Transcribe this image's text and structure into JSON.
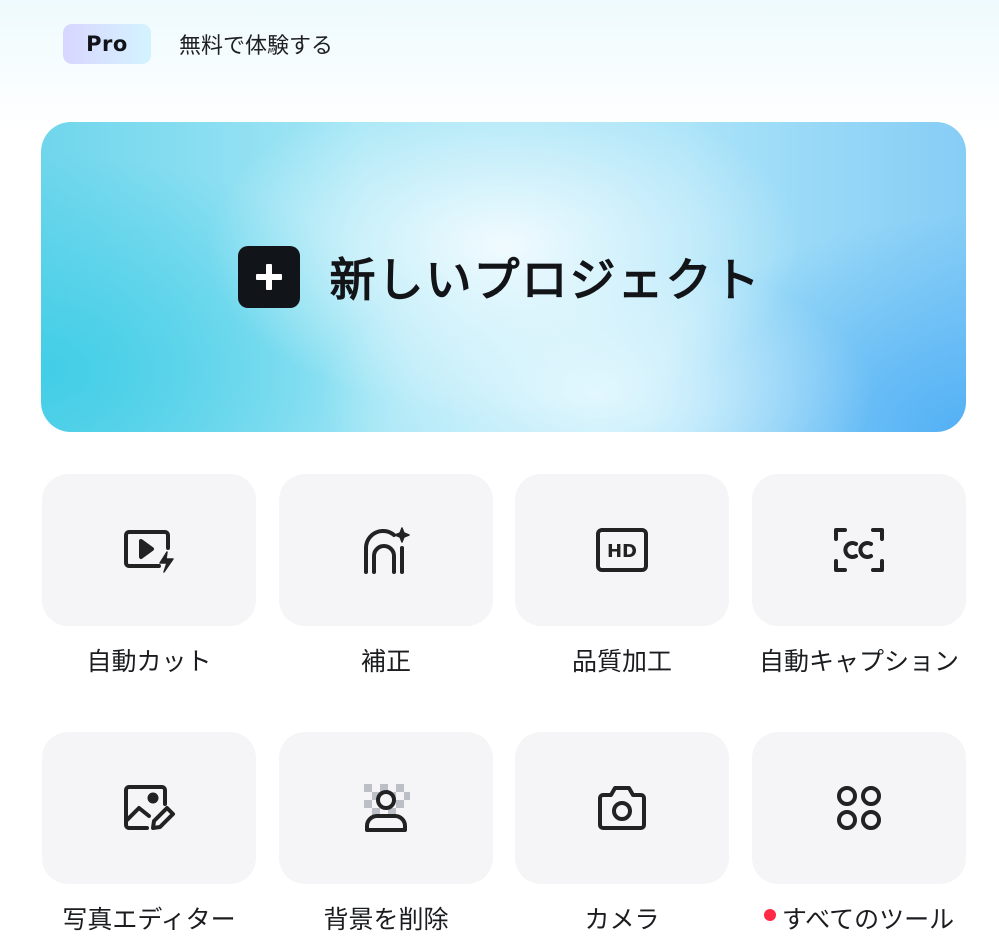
{
  "header": {
    "pro_badge": "Pro",
    "trial_text": "無料で体験する"
  },
  "hero": {
    "title": "新しいプロジェクト"
  },
  "tools": [
    {
      "label": "自動カット",
      "icon": "video-flash-icon"
    },
    {
      "label": "補正",
      "icon": "face-sparkle-icon"
    },
    {
      "label": "品質加工",
      "icon": "hd-icon"
    },
    {
      "label": "自動キャプション",
      "icon": "cc-caption-icon"
    },
    {
      "label": "写真エディター",
      "icon": "image-edit-icon"
    },
    {
      "label": "背景を削除",
      "icon": "remove-background-icon"
    },
    {
      "label": "カメラ",
      "icon": "camera-icon"
    },
    {
      "label": "すべてのツール",
      "icon": "grid-dots-icon",
      "badge": "new-dot"
    }
  ],
  "colors": {
    "tile_background": "#f5f5f7",
    "text": "#1b1c1f",
    "badge_dot": "#ff2a45",
    "plus_box": "#111418"
  }
}
